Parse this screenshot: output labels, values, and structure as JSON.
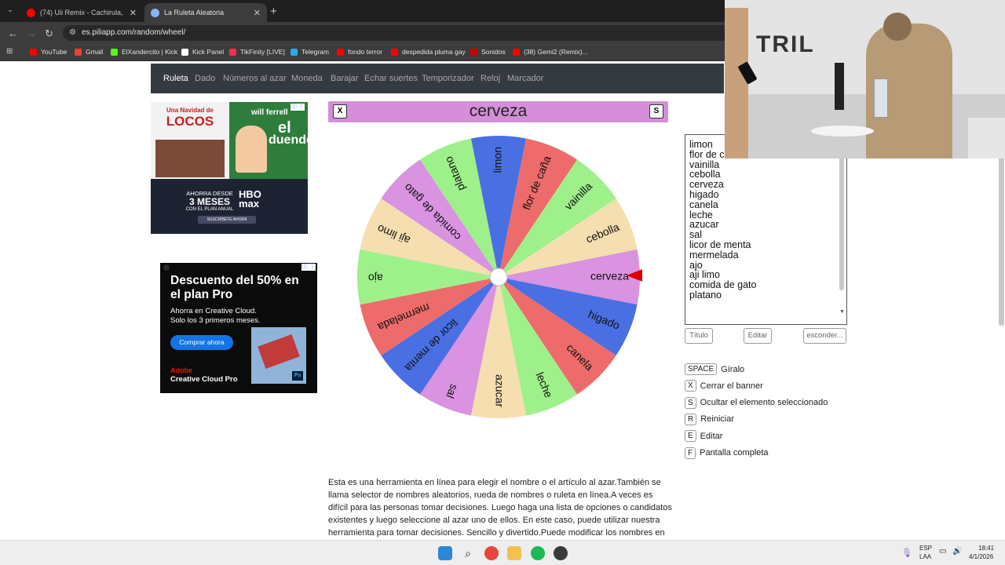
{
  "browser": {
    "tabs": [
      {
        "title": "(74) Uii Remix - Cachirula, Looji",
        "favicon_color": "#ff0000"
      },
      {
        "title": "La Ruleta Aleatoria",
        "favicon_color": "#8ab4f8"
      }
    ],
    "url": "es.piliapp.com/random/wheel/",
    "bookmarks": [
      {
        "label": "YouTube",
        "icon_color": "#ff0000"
      },
      {
        "label": "Gmail",
        "icon_color": "#ea4335"
      },
      {
        "label": "ElXandercito | Kick",
        "icon_color": "#53fc18"
      },
      {
        "label": "Kick Panel",
        "icon_color": "#ffffff"
      },
      {
        "label": "TikFinity [LIVE]",
        "icon_color": "#fe2c55"
      },
      {
        "label": "Telegram",
        "icon_color": "#2aabee"
      },
      {
        "label": "fondo terror",
        "icon_color": "#ff0000"
      },
      {
        "label": "despedida pluma gay",
        "icon_color": "#ff0000"
      },
      {
        "label": "Sonidos",
        "icon_color": "#cc0000"
      },
      {
        "label": "(38) Gemi2 (Remix)...",
        "icon_color": "#ff0000"
      }
    ]
  },
  "sitenav": [
    "Ruleta",
    "Dado",
    "Números al azar",
    "Moneda",
    "Barajar",
    "Echar suertes",
    "Temporizador",
    "Reloj",
    "Marcador"
  ],
  "selected": {
    "text": "cerveza",
    "close_key": "X",
    "hide_key": "S"
  },
  "wheel": {
    "segments": [
      {
        "label": "limon",
        "color": "#4a6fe3"
      },
      {
        "label": "flor de caña",
        "color": "#ee6b6b"
      },
      {
        "label": "vainilla",
        "color": "#9ef08a"
      },
      {
        "label": "cebolla",
        "color": "#f5deb0"
      },
      {
        "label": "cerveza",
        "color": "#d993e0"
      },
      {
        "label": "higado",
        "color": "#4a6fe3"
      },
      {
        "label": "canela",
        "color": "#ee6b6b"
      },
      {
        "label": "leche",
        "color": "#9ef08a"
      },
      {
        "label": "azucar",
        "color": "#f5deb0"
      },
      {
        "label": "sal",
        "color": "#d993e0"
      },
      {
        "label": "licor de menta",
        "color": "#4a6fe3"
      },
      {
        "label": "mermelada",
        "color": "#ee6b6b"
      },
      {
        "label": "ajo",
        "color": "#9ef08a"
      },
      {
        "label": "aji limo",
        "color": "#f5deb0"
      },
      {
        "label": "comida de gato",
        "color": "#d993e0"
      },
      {
        "label": "platano",
        "color": "#9ef08a"
      }
    ],
    "pointer_color": "#e00000"
  },
  "textarea_lines": [
    "limon",
    "flor de caña",
    "vainilla",
    "cebolla",
    "cerveza",
    "higado",
    "canela",
    "leche",
    "azucar",
    "sal",
    "licor de menta",
    "mermelada",
    "ajo",
    "aji limo",
    "comida de gato",
    "platano"
  ],
  "buttons": {
    "title": "Título",
    "edit": "Editar",
    "hide": "esconder..."
  },
  "shortcuts": [
    {
      "key": "SPACE",
      "label": "Gíralo"
    },
    {
      "key": "X",
      "label": "Cerrar el banner"
    },
    {
      "key": "S",
      "label": "Ocultar el elemento seleccionado"
    },
    {
      "key": "R",
      "label": "Reiniciar"
    },
    {
      "key": "E",
      "label": "Editar"
    },
    {
      "key": "F",
      "label": "Pantalla completa"
    }
  ],
  "description": "Esta es una herramienta en línea para elegir el nombre o el artículo al azar.También se llama selector de nombres aleatorios, rueda de nombres o ruleta en línea.A veces es difícil para las personas tomar decisiones. Luego haga una lista de opciones o candidatos existentes y luego seleccione al azar uno de ellos. En este caso, puede utilizar nuestra herramienta para tomar decisiones. Sencillo y divertido.Puede modificar los nombres en textarea, poner un",
  "ad1": {
    "movie_title_line1": "Una Navidad de",
    "movie_title_line2": "LOCOS",
    "actor": "will ferrell",
    "movie2_line1": "el",
    "movie2_line2": "duende",
    "promo_line1": "AHORRA DESDE",
    "promo_line2": "3 MESES",
    "promo_line3": "CON EL PLAN ANUAL",
    "brand": "HBO max",
    "cta": "SUSCRÍBETE AHORA"
  },
  "ad2": {
    "headline": "Descuento del 50% en el plan Pro",
    "body": "Ahorra en Creative Cloud. Solo los 3 primeros meses.",
    "cta": "Comprar ahora",
    "brand_top": "Adobe",
    "brand_bottom": "Creative Cloud Pro",
    "app_badge": "Ps"
  },
  "webcam": {
    "sign_text": "TRIL"
  },
  "taskbar": {
    "lang1": "ESP",
    "lang2": "LAA",
    "time": "18:41",
    "date": "4/1/2026"
  }
}
